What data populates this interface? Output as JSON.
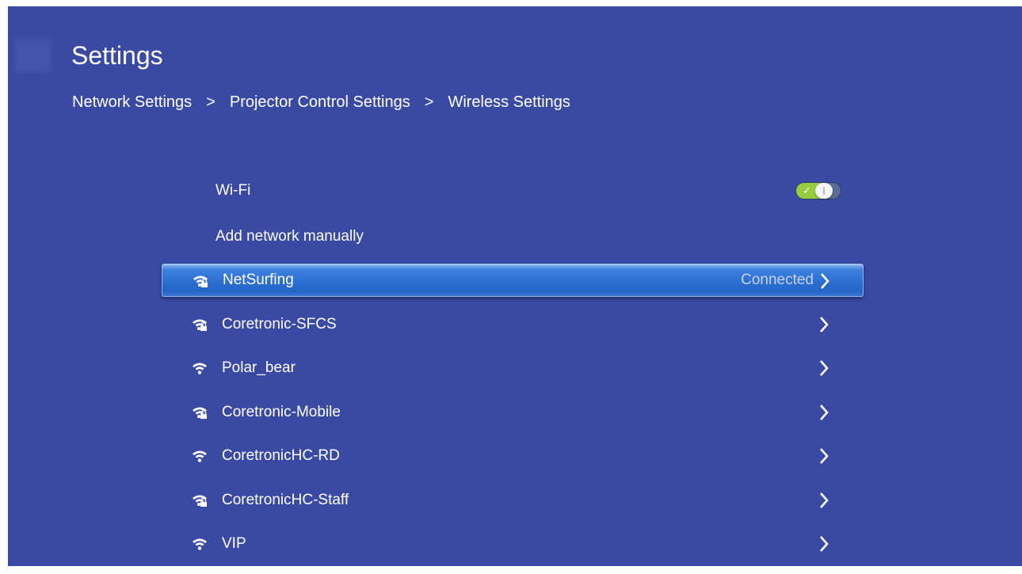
{
  "header": {
    "title": "Settings",
    "breadcrumb": [
      "Network Settings",
      "Projector Control Settings",
      "Wireless Settings"
    ],
    "separator": ">"
  },
  "wifi_toggle": {
    "label": "Wi-Fi",
    "state": "on",
    "color_on": "#97cc3e"
  },
  "add_network": {
    "label": "Add network manually"
  },
  "networks": [
    {
      "name": "NetSurfing",
      "status": "Connected",
      "secured": true,
      "selected": true
    },
    {
      "name": "Coretronic-SFCS",
      "status": "",
      "secured": true
    },
    {
      "name": "Polar_bear",
      "status": "",
      "secured": false
    },
    {
      "name": "Coretronic-Mobile",
      "status": "",
      "secured": true
    },
    {
      "name": "CoretronicHC-RD",
      "status": "",
      "secured": false
    },
    {
      "name": "CoretronicHC-Staff",
      "status": "",
      "secured": true
    },
    {
      "name": "VIP",
      "status": "",
      "secured": false
    }
  ],
  "icons": {
    "wifi_secured": "wifi-lock-icon",
    "wifi_open": "wifi-icon",
    "chevron": "chevron-right-icon"
  },
  "colors": {
    "background": "#3a4aa3",
    "selection": "#2c6fd2",
    "text": "#ffffff"
  }
}
